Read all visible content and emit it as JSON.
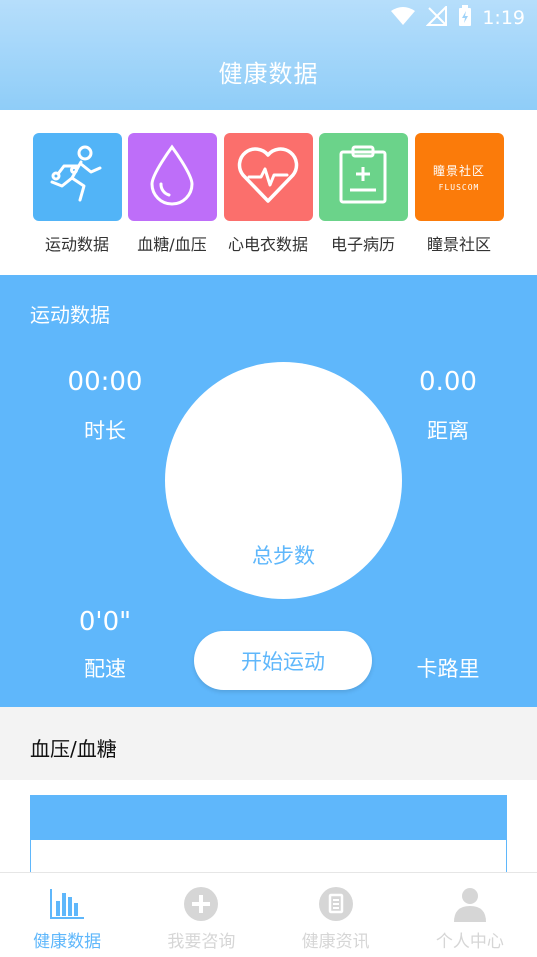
{
  "status_bar": {
    "time": "1:19"
  },
  "header": {
    "title": "健康数据"
  },
  "shortcuts": [
    {
      "label": "运动数据",
      "icon": "runner-icon",
      "color": "#52b4f7"
    },
    {
      "label": "血糖/血压",
      "icon": "drop-icon",
      "color": "#be6ef9"
    },
    {
      "label": "心电衣数据",
      "icon": "heartbeat-icon",
      "color": "#fb6f6c"
    },
    {
      "label": "电子病历",
      "icon": "clipboard-icon",
      "color": "#6bd38a"
    },
    {
      "label": "瞳景社区",
      "icon": "fluscom-logo",
      "color": "#fb7b0a",
      "brand_cn": "瞳景社区",
      "brand_en": "FLUSCOM"
    }
  ],
  "exercise": {
    "title": "运动数据",
    "duration_value": "00:00",
    "duration_label": "时长",
    "distance_value": "0.00",
    "distance_label": "距离",
    "steps_label": "总步数",
    "pace_value": "0'0\"",
    "pace_label": "配速",
    "calories_label": "卡路里",
    "start_button": "开始运动"
  },
  "bp": {
    "title": "血压/血糖"
  },
  "bottom_nav": [
    {
      "label": "健康数据",
      "icon": "bar-chart-icon",
      "active": true
    },
    {
      "label": "我要咨询",
      "icon": "plus-circle-icon",
      "active": false
    },
    {
      "label": "健康资讯",
      "icon": "document-icon",
      "active": false
    },
    {
      "label": "个人中心",
      "icon": "person-icon",
      "active": false
    }
  ],
  "colors": {
    "primary": "#5fb7fb",
    "header_top": "#b6defb",
    "nav_inactive": "#d6d6d6"
  }
}
